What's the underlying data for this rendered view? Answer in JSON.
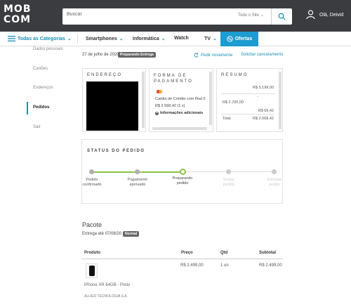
{
  "header": {
    "logo_top": "MOB",
    "logo_bottom": "COM",
    "search_placeholder": "Buscar",
    "search_scope": "Todo o Site",
    "user_greeting": "Olá, Deivid"
  },
  "nav": {
    "categories": "Todas as Categorias",
    "items": [
      "Smartphones",
      "Informática",
      "Watch",
      "TV"
    ],
    "offers": "Ofertas"
  },
  "sidebar": {
    "items": [
      "Dados pessoais",
      "Cartões",
      "Endereços",
      "Pedidos",
      "Sair"
    ]
  },
  "order": {
    "date": "27 de julho de 2020",
    "status_badge": "Preparando Entrega",
    "reorder": "Pedir novamente",
    "cancel": "Solicitar cancelamento"
  },
  "address": {
    "title": "ENDEREÇO"
  },
  "payment": {
    "title_line1": "FORMA DE",
    "title_line2": "PAGAMENTO",
    "card_text": "Cartão de Crédito com final 0",
    "amount": "R$ 2.568,42 (1 x)",
    "more_info": "Informações adicionais"
  },
  "summary": {
    "title": "RESUMO",
    "line1": "R$ 5.199,00",
    "line2": "R$ 2.700,00",
    "line3": "R$ 69,42",
    "total_label": "Total",
    "total_value": "R$ 2.568,42"
  },
  "status": {
    "title": "STATUS DO PEDIDO",
    "steps": [
      {
        "l1": "Pedido",
        "l2": "confirmado"
      },
      {
        "l1": "Pagamento",
        "l2": "aprovado"
      },
      {
        "l1": "Preparando",
        "l2": "pedido"
      },
      {
        "l1": "Enviar",
        "l2": "pedido"
      },
      {
        "l1": "Entregar",
        "l2": "pedido"
      }
    ]
  },
  "package": {
    "title": "Pacote",
    "delivery": "Entrega até 07/08/20",
    "delivery_badge": "Normal",
    "col_product": "Produto",
    "col_price": "Preço",
    "col_qty": "Qtd",
    "col_subtotal": "Subtotal",
    "price": "R$ 2.499,00",
    "qty": "1 un",
    "subtotal": "R$ 2.499,00",
    "product_name": "iPhone XR 64GB - Preto",
    "seller": "ALLIED TECNOLOGIA S.A."
  },
  "colors": {
    "accent": "#1b8fb3",
    "topbar": "#3a3c3f",
    "progress": "#8bc34a"
  }
}
